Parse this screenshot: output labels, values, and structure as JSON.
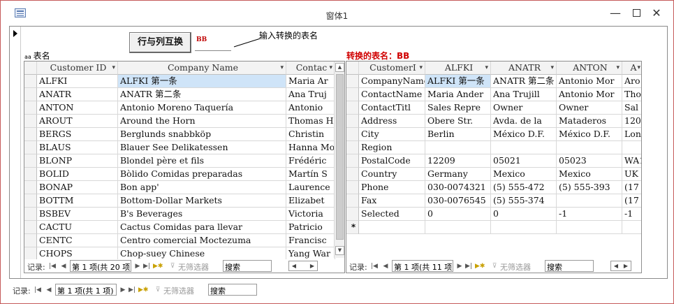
{
  "window": {
    "title": "窗体1",
    "minimize_glyph": "—",
    "close_glyph": "✕"
  },
  "form": {
    "swap_button_label": "行与列互换",
    "table_name_value": "BB",
    "callout_label": "输入转换的表名",
    "left_label_prefix": "aa",
    "left_label": "表名",
    "right_label": "转换的表名：BB",
    "accent_color": "#c00000"
  },
  "left_grid": {
    "columns": [
      "Customer ID",
      "Company Name",
      "Contac"
    ],
    "rows": [
      [
        "ALFKI",
        "ALFKI 第一条",
        "Maria Ar"
      ],
      [
        "ANATR",
        "ANATR 第二条",
        "Ana Truj"
      ],
      [
        "ANTON",
        "Antonio Moreno Taquería",
        "Antonio"
      ],
      [
        "AROUT",
        "Around the Horn",
        "Thomas H"
      ],
      [
        "BERGS",
        "Berglunds snabbköp",
        "Christin"
      ],
      [
        "BLAUS",
        "Blauer See Delikatessen",
        "Hanna Mo"
      ],
      [
        "BLONP",
        "Blondel père et fils",
        "Frédéric"
      ],
      [
        "BOLID",
        "Bòlido Comidas preparadas",
        "Martín S"
      ],
      [
        "BONAP",
        "Bon app'",
        "Laurence"
      ],
      [
        "BOTTM",
        "Bottom-Dollar Markets",
        "Elizabet"
      ],
      [
        "BSBEV",
        "B's Beverages",
        "Victoria"
      ],
      [
        "CACTU",
        "Cactus Comidas para llevar",
        "Patricio"
      ],
      [
        "CENTC",
        "Centro comercial Moctezuma",
        "Francisc"
      ],
      [
        "CHOPS",
        "Chop-suey Chinese",
        "Yang War"
      ]
    ],
    "nav": {
      "label": "记录:",
      "record": "第 1 项(共 20 项",
      "filter": "无筛选器",
      "search": "搜索"
    }
  },
  "right_grid": {
    "columns": [
      "CustomerI",
      "ALFKI",
      "ANATR",
      "ANTON",
      "A"
    ],
    "rows": [
      [
        "CompanyName",
        "ALFKI 第一条",
        "ANATR 第二条",
        "Antonio Mor",
        "Aro"
      ],
      [
        "ContactName",
        "Maria Ander",
        "Ana Trujill",
        "Antonio Mor",
        "Tho"
      ],
      [
        "ContactTitl",
        "Sales Repre",
        "Owner",
        "Owner",
        "Sal"
      ],
      [
        "Address",
        "Obere Str.",
        "Avda. de la",
        "Mataderos",
        "120"
      ],
      [
        "City",
        "Berlin",
        "México D.F.",
        "México D.F.",
        "Lon"
      ],
      [
        "Region",
        "",
        "",
        "",
        ""
      ],
      [
        "PostalCode",
        "12209",
        "05021",
        "05023",
        "WA1"
      ],
      [
        "Country",
        "Germany",
        "Mexico",
        "Mexico",
        "UK"
      ],
      [
        "Phone",
        "030-0074321",
        "(5) 555-472",
        "(5) 555-393",
        "(17"
      ],
      [
        "Fax",
        "030-0076545",
        "(5) 555-374",
        "",
        "(17"
      ],
      [
        "Selected",
        "0",
        "0",
        "-1",
        "-1"
      ]
    ],
    "new_row_marker": "*",
    "nav": {
      "label": "记录:",
      "record": "第 1 项(共 11 项",
      "filter": "无筛选器",
      "search": "搜索"
    }
  },
  "main_nav": {
    "label": "记录:",
    "record": "第 1 项(共 1 项)",
    "filter": "无筛选器",
    "search": "搜索"
  }
}
